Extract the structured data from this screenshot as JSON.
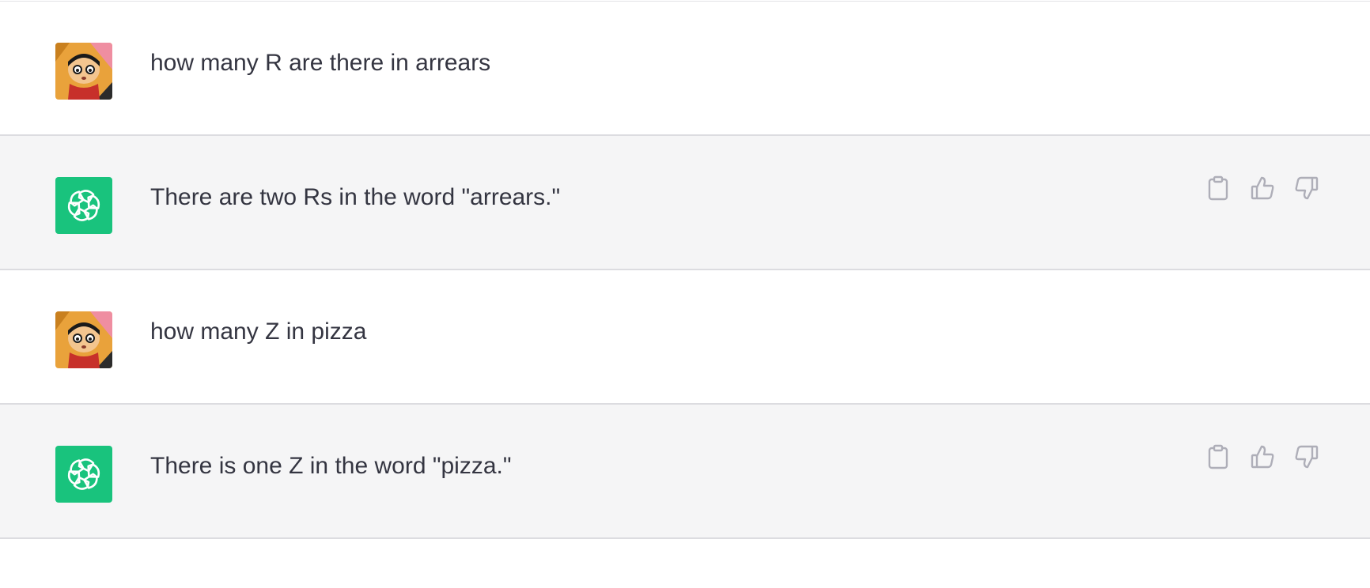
{
  "conversation": {
    "messages": [
      {
        "role": "user",
        "avatar_icon": "user-avatar-cartoon-icon",
        "text": "how many R are there in arrears"
      },
      {
        "role": "assistant",
        "avatar_icon": "openai-logo-icon",
        "text": "There are two Rs in the word \"arrears.\""
      },
      {
        "role": "user",
        "avatar_icon": "user-avatar-cartoon-icon",
        "text": "how many Z in pizza"
      },
      {
        "role": "assistant",
        "avatar_icon": "openai-logo-icon",
        "text": "There is one Z in the word \"pizza.\""
      }
    ],
    "action_icons": [
      "clipboard-icon",
      "thumbs-up-icon",
      "thumbs-down-icon"
    ]
  },
  "colors": {
    "assistant_brand": "#19c37d",
    "assistant_row_bg": "#f5f5f6",
    "text": "#343541",
    "icon": "#aeaeb8"
  }
}
